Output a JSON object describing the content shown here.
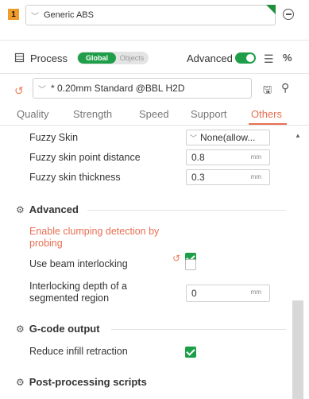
{
  "filament": {
    "slot_number": "1",
    "name": "Generic ABS",
    "color": "#1f8f3c"
  },
  "process": {
    "title": "Process",
    "scope_on": "Global",
    "scope_off": "Objects",
    "advanced_label": "Advanced",
    "advanced_enabled": true,
    "preset": "* 0.20mm Standard @BBL H2D"
  },
  "tabs": [
    {
      "label": "Quality",
      "active": false
    },
    {
      "label": "Strength",
      "active": false
    },
    {
      "label": "Speed",
      "active": false
    },
    {
      "label": "Support",
      "active": false
    },
    {
      "label": "Others",
      "active": true
    }
  ],
  "settings": {
    "fuzzy_skin": {
      "label": "Fuzzy Skin",
      "value": "None(allow..."
    },
    "fuzzy_distance": {
      "label": "Fuzzy skin point distance",
      "value": "0.8",
      "unit": "mm"
    },
    "fuzzy_thickness": {
      "label": "Fuzzy skin thickness",
      "value": "0.3",
      "unit": "mm"
    }
  },
  "sections": {
    "advanced": {
      "title": "Advanced",
      "clumping": {
        "label": "Enable clumping detection by probing",
        "checked": true
      },
      "beam": {
        "label": "Use beam interlocking",
        "checked": false
      },
      "interlocking_depth": {
        "label": "Interlocking depth of a segmented region",
        "value": "0",
        "unit": "mm"
      }
    },
    "gcode": {
      "title": "G-code output",
      "reduce_infill": {
        "label": "Reduce infill retraction",
        "checked": true
      }
    },
    "post": {
      "title": "Post-processing scripts"
    }
  },
  "colors": {
    "accent_orange": "#e86f52",
    "accent_green": "#1f9e4a",
    "slot_badge": "#f09c2b"
  }
}
